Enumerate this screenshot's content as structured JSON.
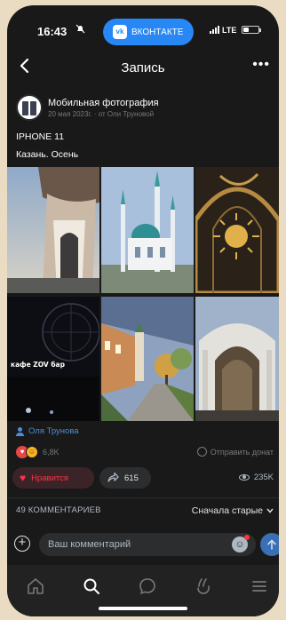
{
  "status_bar": {
    "time": "16:43",
    "mute_icon": "bell-slash",
    "app_pill_label": "ВКОНТАКТЕ",
    "app_logo": "vk",
    "network": "LTE",
    "battery_fraction": 0.35
  },
  "nav": {
    "title": "Запись",
    "back_icon": "chevron-left-icon",
    "more_label": "•••"
  },
  "post": {
    "author": "Мобильная фотография",
    "meta": "20 мая 2023г. · от Оли Труновой",
    "text_line_1": "IPHONE 11",
    "text_line_2": "Казань. Осень",
    "photos": [
      {
        "subject": "modern-tower"
      },
      {
        "subject": "mosque"
      },
      {
        "subject": "golden-sun-gate"
      },
      {
        "subject": "ferris-wheel-night",
        "sign": "кафе ZOV бар"
      },
      {
        "subject": "street-tower-autumn"
      },
      {
        "subject": "ornate-gate"
      }
    ],
    "author_link": "Оля Трунова",
    "reactions_count": "6,8K",
    "donate_label": "Отправить донат",
    "like_label": "Нравится",
    "shares": "615",
    "views": "235K"
  },
  "comments": {
    "title": "49 КОММЕНТАРИЕВ",
    "sort_label": "Сначала старые",
    "input_placeholder": "Ваш комментарий"
  },
  "tabbar": {
    "items": [
      "home-icon",
      "search-icon",
      "messages-icon",
      "clips-icon",
      "menu-icon"
    ]
  },
  "colors": {
    "background": "#19191a",
    "accent": "#2787f5",
    "like": "#ff3347",
    "link": "#4a8fd9"
  }
}
